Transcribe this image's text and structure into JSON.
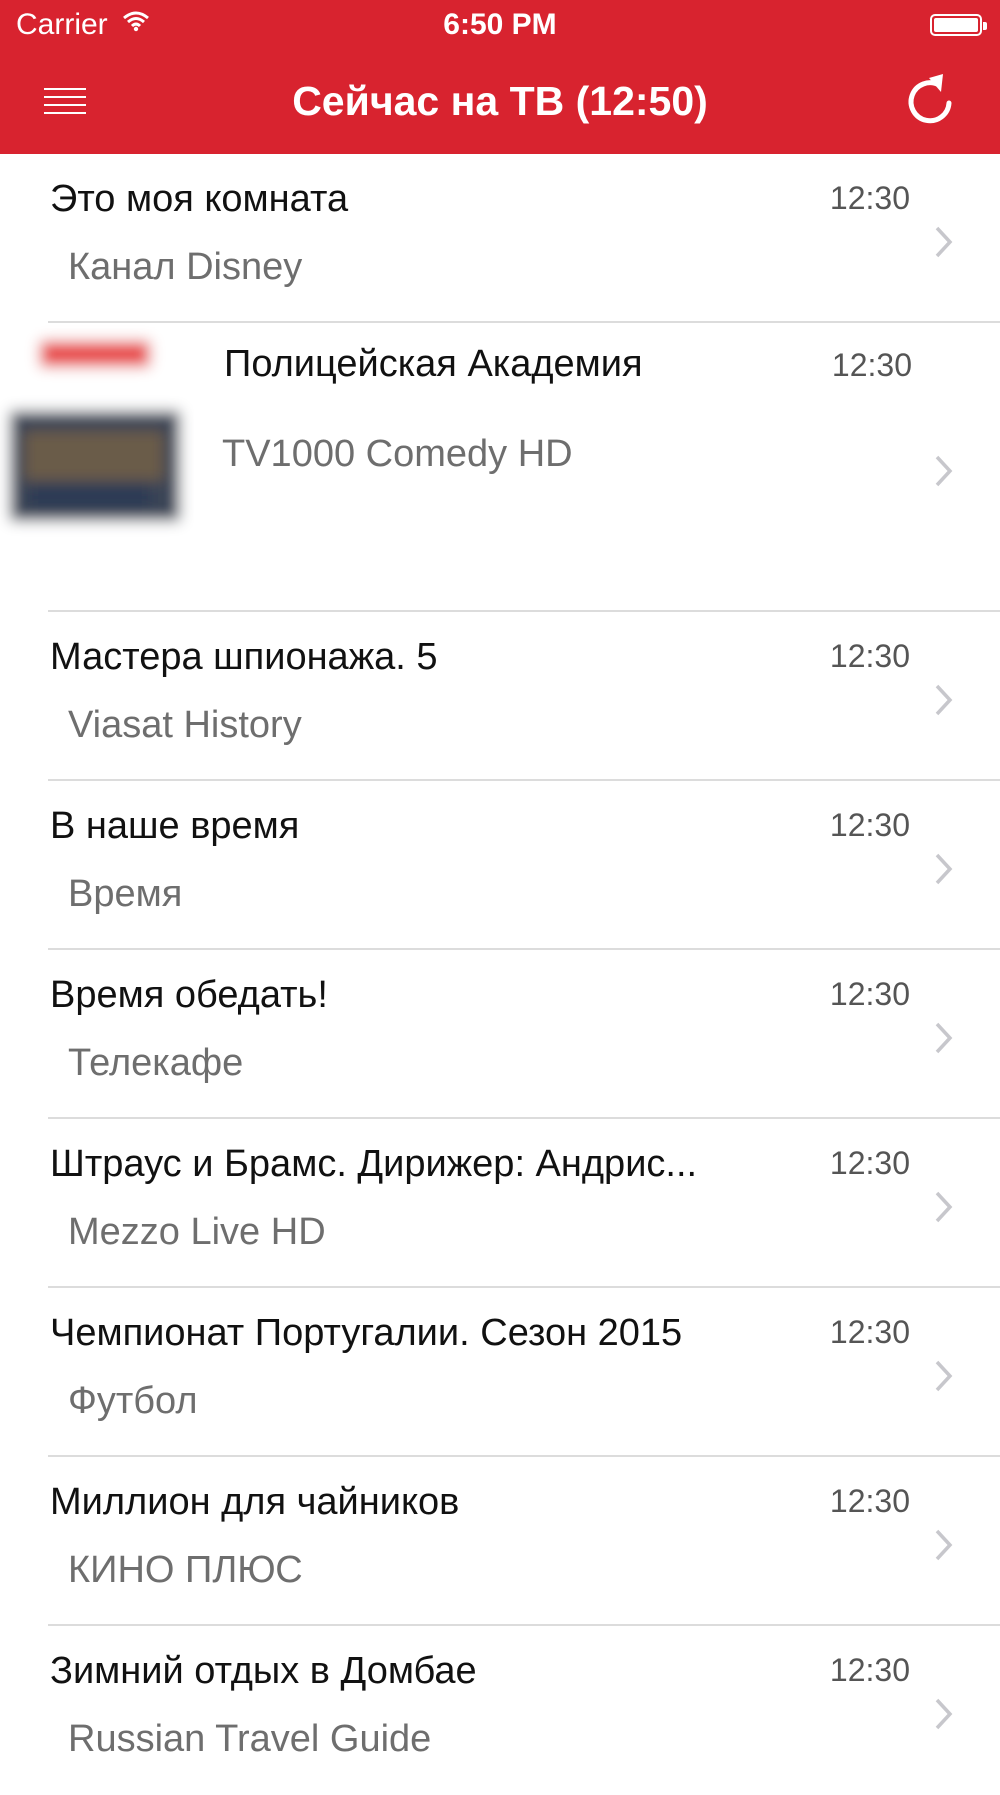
{
  "status": {
    "carrier": "Carrier",
    "time": "6:50 PM"
  },
  "nav": {
    "title": "Сейчас на ТВ (12:50)",
    "menu_icon": "hamburger-menu-icon",
    "refresh_icon": "refresh-icon"
  },
  "colors": {
    "accent": "#d8232f",
    "separator": "#dcdcdc",
    "chevron": "#c7c7cc"
  },
  "programs": [
    {
      "title": "Это моя комната",
      "channel": "Канал Disney",
      "time": "12:30"
    },
    {
      "title": "Полицейская Академия",
      "channel": "TV1000 Comedy HD",
      "time": "12:30"
    },
    {
      "title": "Мастера шпионажа. 5",
      "channel": "Viasat History",
      "time": "12:30"
    },
    {
      "title": "В наше время",
      "channel": "Время",
      "time": "12:30"
    },
    {
      "title": "Время обедать!",
      "channel": "Телекафе",
      "time": "12:30"
    },
    {
      "title": "Штраус и Брамс. Дирижер: Андрис...",
      "channel": "Mezzo Live HD",
      "time": "12:30"
    },
    {
      "title": "Чемпионат Португалии. Сезон 2015",
      "channel": "Футбол",
      "time": "12:30"
    },
    {
      "title": "Миллион для чайников",
      "channel": "КИНО ПЛЮС",
      "time": "12:30"
    },
    {
      "title": "Зимний отдых в Домбае",
      "channel": "Russian Travel Guide",
      "time": "12:30"
    }
  ]
}
